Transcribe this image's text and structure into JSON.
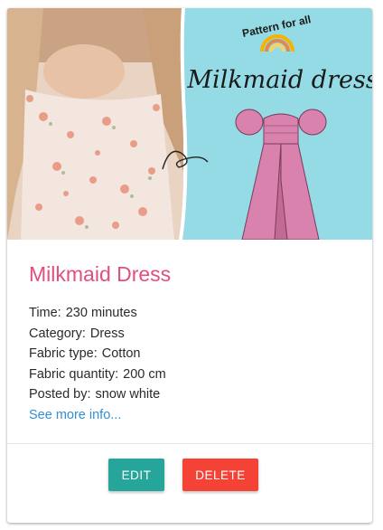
{
  "pattern": {
    "title": "Milkmaid Dress",
    "image": {
      "badge_text": "Pattern for all",
      "script_title": "Milkmaid dress"
    },
    "fields": [
      {
        "label": "Time:",
        "value": "230 minutes"
      },
      {
        "label": "Category:",
        "value": "Dress"
      },
      {
        "label": "Fabric type:",
        "value": "Cotton"
      },
      {
        "label": "Fabric quantity:",
        "value": "200 cm"
      },
      {
        "label": "Posted by:",
        "value": "snow white"
      }
    ],
    "more_link": "See more info..."
  },
  "actions": {
    "edit_label": "EDIT",
    "delete_label": "DELETE"
  },
  "colors": {
    "title": "#e0507a",
    "link": "#2f8fd6",
    "edit_button": "#26a69a",
    "delete_button": "#f44336",
    "image_panel": "#94dbe6",
    "dress": "#d982ad"
  }
}
